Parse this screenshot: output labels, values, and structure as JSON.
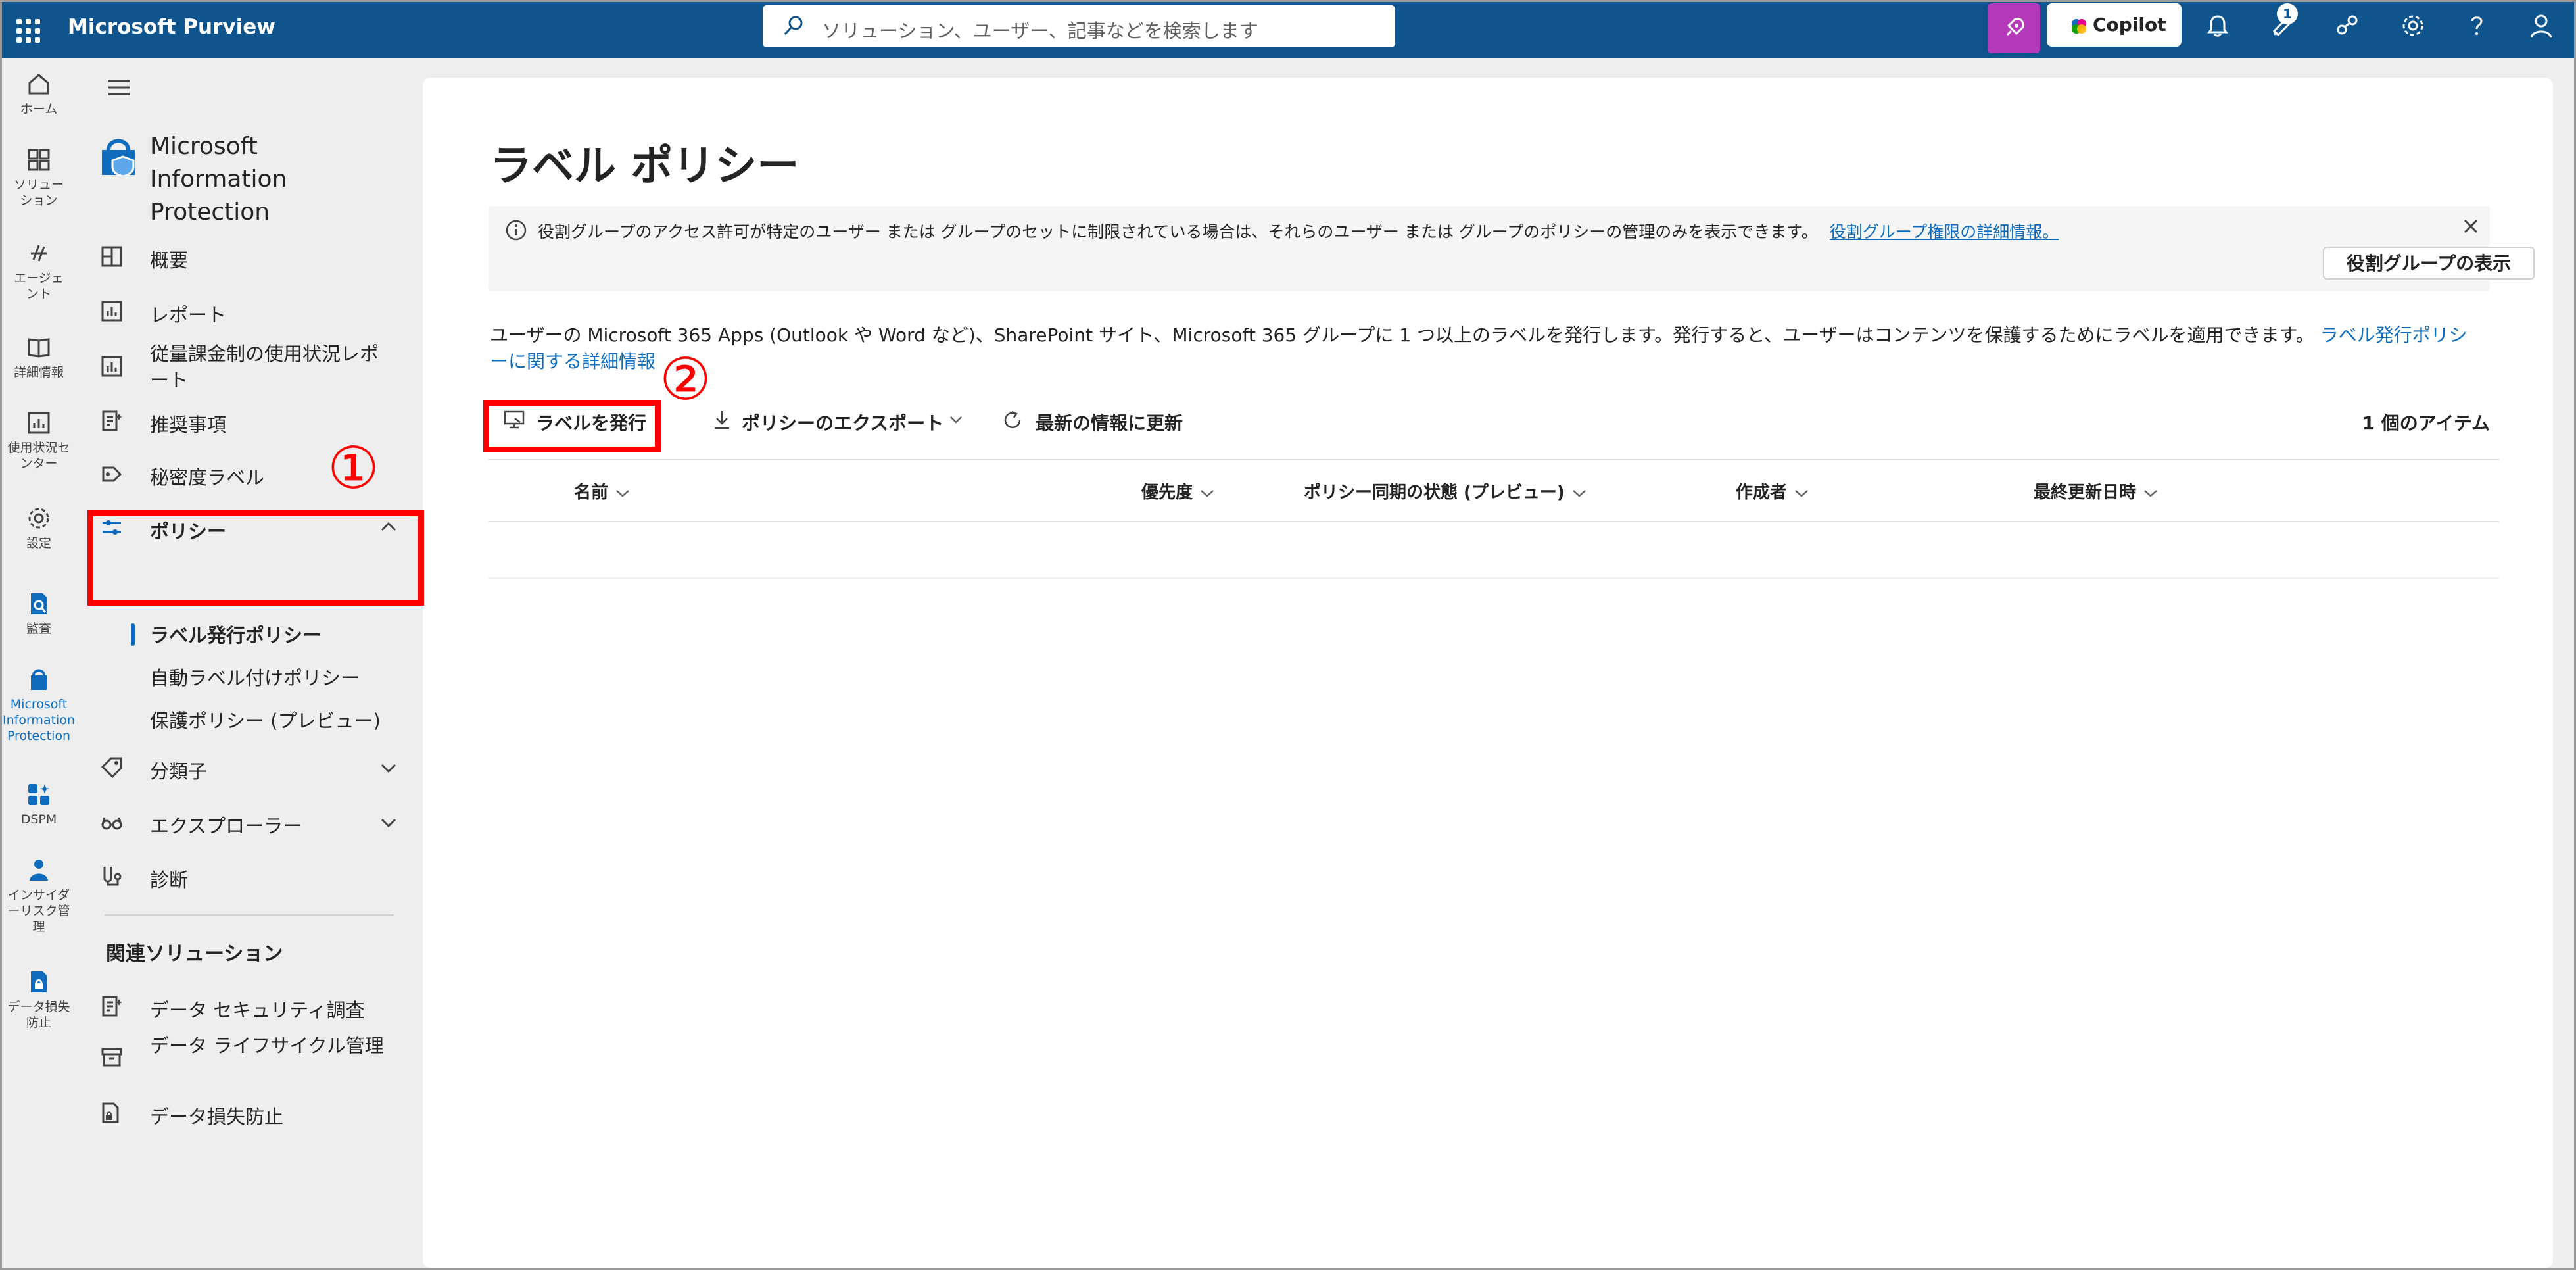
{
  "topbar": {
    "brand": "Microsoft Purview",
    "search_placeholder": "ソリューション、ユーザー、記事などを検索します",
    "copilot_label": "Copilot",
    "notification_badge": "1"
  },
  "rail": {
    "items": [
      {
        "label": "ホーム"
      },
      {
        "label": "ソリューション"
      },
      {
        "label": "エージェント"
      },
      {
        "label": "詳細情報"
      },
      {
        "label": "使用状況センター"
      },
      {
        "label": "設定"
      },
      {
        "label": "監査"
      },
      {
        "label": "Microsoft Information Protection"
      },
      {
        "label": "DSPM"
      },
      {
        "label": "インサイダーリスク管理"
      },
      {
        "label": "データ損失防止"
      }
    ]
  },
  "nav": {
    "title": "Microsoft Information Protection",
    "items": [
      {
        "label": "概要"
      },
      {
        "label": "レポート"
      },
      {
        "label": "従量課金制の使用状況レポート"
      },
      {
        "label": "推奨事項"
      },
      {
        "label": "秘密度ラベル"
      },
      {
        "label": "ポリシー"
      },
      {
        "label": "分類子"
      },
      {
        "label": "エクスプローラー"
      },
      {
        "label": "診断"
      }
    ],
    "policy_subitems": [
      {
        "label": "ラベル発行ポリシー",
        "selected": true
      },
      {
        "label": "自動ラベル付けポリシー"
      },
      {
        "label": "保護ポリシー (プレビュー)"
      }
    ],
    "related_heading": "関連ソリューション",
    "related": [
      {
        "label": "データ セキュリティ調査"
      },
      {
        "label": "データ ライフサイクル管理"
      },
      {
        "label": "データ損失防止"
      }
    ]
  },
  "page": {
    "title": "ラベル ポリシー",
    "banner_text": "役割グループのアクセス許可が特定のユーザー または グループのセットに制限されている場合は、それらのユーザー または グループのポリシーの管理のみを表示できます。",
    "banner_link": "役割グループ権限の詳細情報。",
    "role_group_button": "役割グループの表示",
    "description": "ユーザーの Microsoft 365 Apps (Outlook や Word など)、SharePoint サイト、Microsoft 365 グループに 1 つ以上のラベルを発行します。発行すると、ユーザーはコンテンツを保護するためにラベルを適用できます。",
    "description_link": "ラベル発行ポリシーに関する詳細情報",
    "commands": {
      "publish": "ラベルを発行",
      "export": "ポリシーのエクスポート",
      "refresh": "最新の情報に更新"
    },
    "item_count": "1 個のアイテム",
    "columns": [
      "名前",
      "優先度",
      "ポリシー同期の状態 (プレビュー)",
      "作成者",
      "最終更新日時"
    ]
  },
  "annotations": {
    "step1": "①",
    "step2": "②",
    "highlight_color": "#ff0000"
  },
  "colors": {
    "topbar": "#0f548c",
    "accent": "#0f6cbd",
    "copilot_button": "#b43ab9"
  }
}
